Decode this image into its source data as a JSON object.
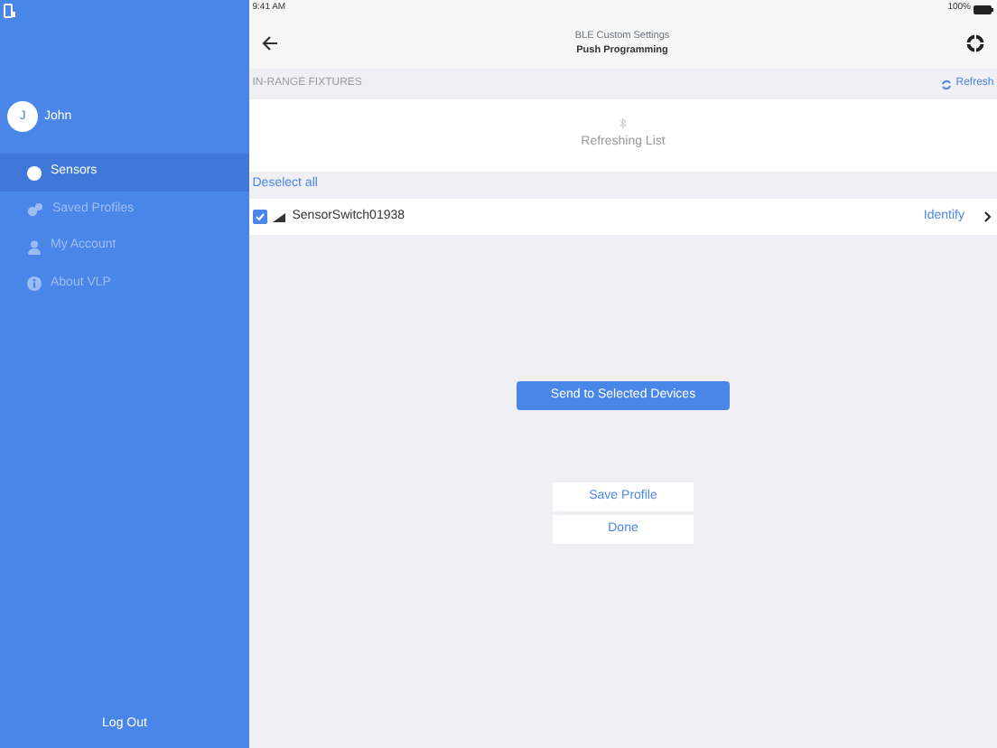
{
  "status_bar": {
    "time": "9:41 AM",
    "battery": "100%"
  },
  "sidebar": {
    "user": {
      "initial": "J",
      "name": "John"
    },
    "items": [
      {
        "label": "Sensors",
        "selected": true
      },
      {
        "label": "Saved Profiles",
        "selected": false
      },
      {
        "label": "My Account",
        "selected": false
      },
      {
        "label": "About VLP",
        "selected": false
      }
    ],
    "logout": "Log Out"
  },
  "header": {
    "title": "BLE Custom Settings",
    "subtitle": "Push Programming"
  },
  "section": {
    "title": "IN-RANGE FIXTURES",
    "refresh": "Refresh"
  },
  "refreshing": "Refreshing List",
  "deselect_all": "Deselect all",
  "devices": [
    {
      "name": "SensorSwitch01938",
      "checked": true,
      "action": "Identify"
    }
  ],
  "send_button": "Send to Selected Devices",
  "buttons": [
    "Save Profile",
    "Done"
  ]
}
